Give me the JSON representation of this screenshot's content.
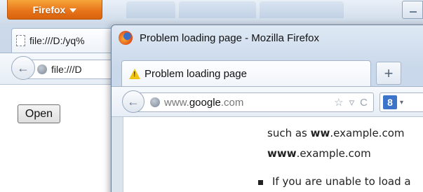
{
  "back_window": {
    "firefox_menu": "Firefox",
    "tab": {
      "label": "file:///D:/yq%"
    },
    "url": "file:///D",
    "open_button": "Open"
  },
  "front_window": {
    "title": "Problem loading page - Mozilla Firefox",
    "tab": {
      "label": "Problem loading page"
    },
    "new_tab": "+",
    "url": {
      "prefix": "www.",
      "domain": "google",
      "suffix": ".com"
    },
    "search_engine_label": "8",
    "content": {
      "line1_before": "such as ",
      "line1_bold": "ww",
      "line1_after": ".example.com",
      "line2_bold": "www",
      "line2_after": ".example.com",
      "line3": "If you are unable to load a"
    }
  }
}
